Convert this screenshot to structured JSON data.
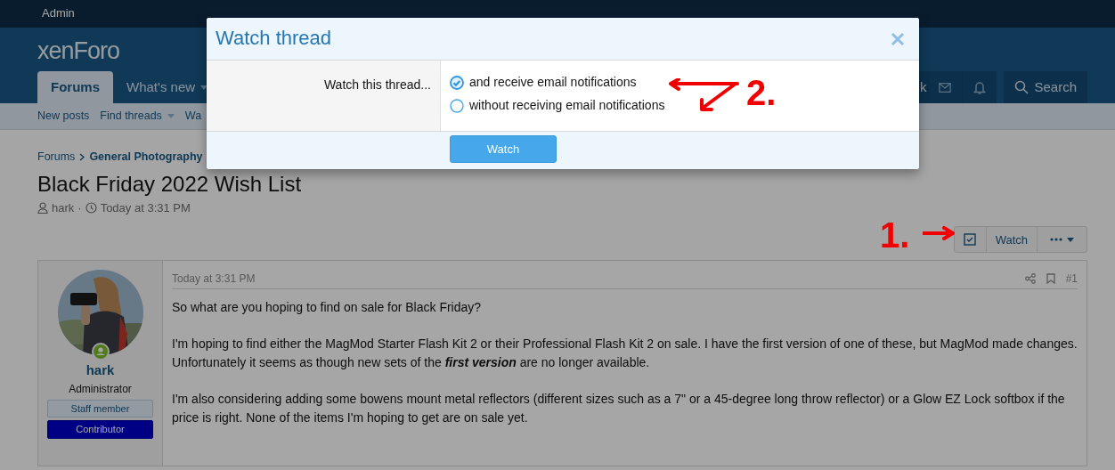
{
  "admin_bar": {
    "label": "Admin"
  },
  "header": {
    "logo": "xenForo",
    "tabs": [
      {
        "label": "Forums",
        "selected": true,
        "has_menu": false
      },
      {
        "label": "What's new",
        "selected": false,
        "has_menu": true
      }
    ],
    "hidden_tab_tail": "k",
    "search_label": "Search"
  },
  "subnav": [
    {
      "label": "New posts",
      "has_menu": false
    },
    {
      "label": "Find threads",
      "has_menu": true
    },
    {
      "label": "Wa",
      "has_menu": false
    }
  ],
  "breadcrumb": [
    {
      "label": "Forums",
      "kind": "link"
    },
    {
      "label": "General Photography",
      "kind": "parent"
    }
  ],
  "thread": {
    "title": "Black Friday 2022 Wish List",
    "author": "hark",
    "separator": "·",
    "time": "Today at 3:31 PM"
  },
  "thread_actions": {
    "watch_label": "Watch"
  },
  "post": {
    "user": {
      "name": "hark",
      "title": "Administrator",
      "online": true,
      "banners": [
        {
          "label": "Staff member",
          "kind": "staff"
        },
        {
          "label": "Contributor",
          "kind": "contributor"
        }
      ]
    },
    "time": "Today at 3:31 PM",
    "number": "#1",
    "paragraphs": [
      "So what are you hoping to find on sale for Black Friday?",
      "I'm hoping to find either the MagMod Starter Flash Kit 2 or their Professional Flash Kit 2 on sale. I have the first version of one of these, but MagMod made changes. Unfortunately it seems as though new sets of the **first version** are no longer available.",
      "I'm also considering adding some bowens mount metal reflectors (different sizes such as a 7\" or a 45-degree long throw reflector) or a Glow EZ Lock softbox if the price is right. None of the items I'm hoping to get are on sale yet."
    ]
  },
  "modal": {
    "title": "Watch thread",
    "label": "Watch this thread...",
    "options": [
      {
        "label": "and receive email notifications",
        "selected": true
      },
      {
        "label": "without receiving email notifications",
        "selected": false
      }
    ],
    "button": "Watch"
  },
  "annotations": [
    {
      "label": "1."
    },
    {
      "label": "2."
    }
  ]
}
